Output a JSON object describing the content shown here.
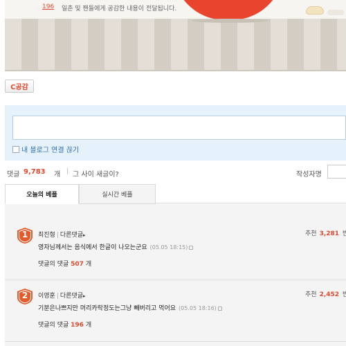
{
  "empathy": {
    "button_label": "C공감",
    "count": "196",
    "message": "일촌 및 팬들에게 공감한 내용이 전달됩니다."
  },
  "write": {
    "blog_toggle_label": "내 블로그 연결 끊기"
  },
  "count_row": {
    "label": "댓글",
    "count": "9,783",
    "unit": "개",
    "separator": "|",
    "prompt": "그 사이 새글이?",
    "author_label": "작성자명"
  },
  "tabs": [
    {
      "label": "오늘의 베플"
    },
    {
      "label": "실시간 베플"
    }
  ],
  "comments": [
    {
      "rank": "1",
      "author": "최진형",
      "separator": "|",
      "other_link": "다른댓글",
      "arrow": "▸",
      "recommend_label": "추천",
      "recommend_count": "3,281",
      "recommend_cut": "반",
      "text": "영자님께서는 음식에서 한글이 나오는군요",
      "time": "(05.05 18:15)",
      "reply_label": "댓글의 댓글",
      "reply_count": "507",
      "reply_unit": "개"
    },
    {
      "rank": "2",
      "author": "이영훈",
      "separator": "|",
      "other_link": "다른댓글",
      "arrow": "▸",
      "recommend_label": "추천",
      "recommend_count": "2,452",
      "recommend_cut": "반",
      "text": "기분은나쁘지만 머리카락정도는그냥 빼버리고 먹어요",
      "time": "(05.05 18:16)",
      "reply_label": "댓글의 댓글",
      "reply_count": "196",
      "reply_unit": "개"
    }
  ],
  "colors": {
    "accent_red": "#e04a2f",
    "link_blue": "#2a6fb0",
    "rank_badge": "#e35b2b"
  }
}
